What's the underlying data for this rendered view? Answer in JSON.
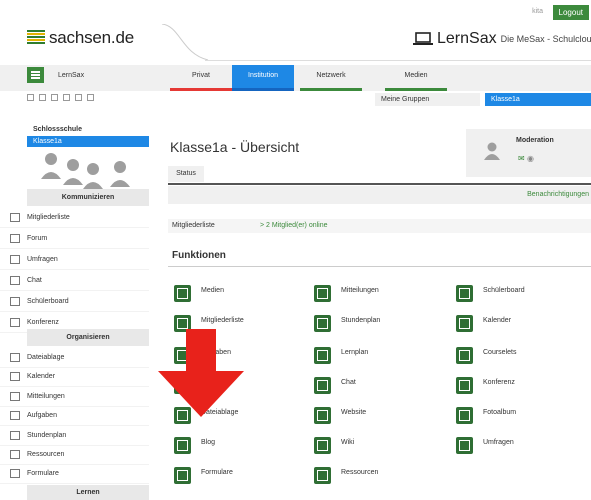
{
  "top": {
    "user": "kita",
    "logout": "Logout"
  },
  "header": {
    "brand": "sachsen.de",
    "product": "LernSax",
    "product_sub": "Die MeSax - Schulcloud"
  },
  "nav": {
    "lernsax": "LernSax",
    "tabs": [
      {
        "label": "Privat",
        "color": "#e53935",
        "active": false
      },
      {
        "label": "Institution",
        "color": "#1e88e5",
        "active": true
      },
      {
        "label": "Netzwerk",
        "color": "#3c8a3c",
        "active": false
      },
      {
        "label": "Medien",
        "color": "#3c8a3c",
        "active": false
      }
    ]
  },
  "toolbar": {
    "my_groups": "Meine Gruppen",
    "current_group": "Klasse1a"
  },
  "sidebar": {
    "school": "Schlossschule",
    "active_class": "Klasse1a",
    "sections": {
      "communicate": "Kommunizieren",
      "organize": "Organisieren",
      "learn": "Lernen"
    },
    "communicate_items": [
      "Mitgliederliste",
      "Forum",
      "Umfragen",
      "Chat",
      "Schülerboard",
      "Konferenz"
    ],
    "organize_items": [
      "Dateiablage",
      "Kalender",
      "Mitteilungen",
      "Aufgaben",
      "Stundenplan",
      "Ressourcen",
      "Formulare"
    ]
  },
  "main": {
    "title": "Klasse1a - Übersicht",
    "moderation": "Moderation",
    "status_tab": "Status",
    "notifications": "Benachrichtigungen",
    "members_label": "Mitgliederliste",
    "members_online": "> 2 Mitglied(er) online",
    "functions_title": "Funktionen",
    "functions": [
      [
        "Medien",
        "Mitteilungen",
        "Schülerboard"
      ],
      [
        "Mitgliederliste",
        "Stundenplan",
        "Kalender"
      ],
      [
        "Aufgaben",
        "Lernplan",
        "Courselets"
      ],
      [
        "",
        "Chat",
        "Konferenz"
      ],
      [
        "Dateiablage",
        "Website",
        "Fotoalbum"
      ],
      [
        "Blog",
        "Wiki",
        "Umfragen"
      ],
      [
        "Formulare",
        "Ressourcen",
        ""
      ]
    ]
  },
  "colors": {
    "accent": "#1e88e5",
    "brand_green": "#2f6e34",
    "arrow": "#e8221b"
  }
}
